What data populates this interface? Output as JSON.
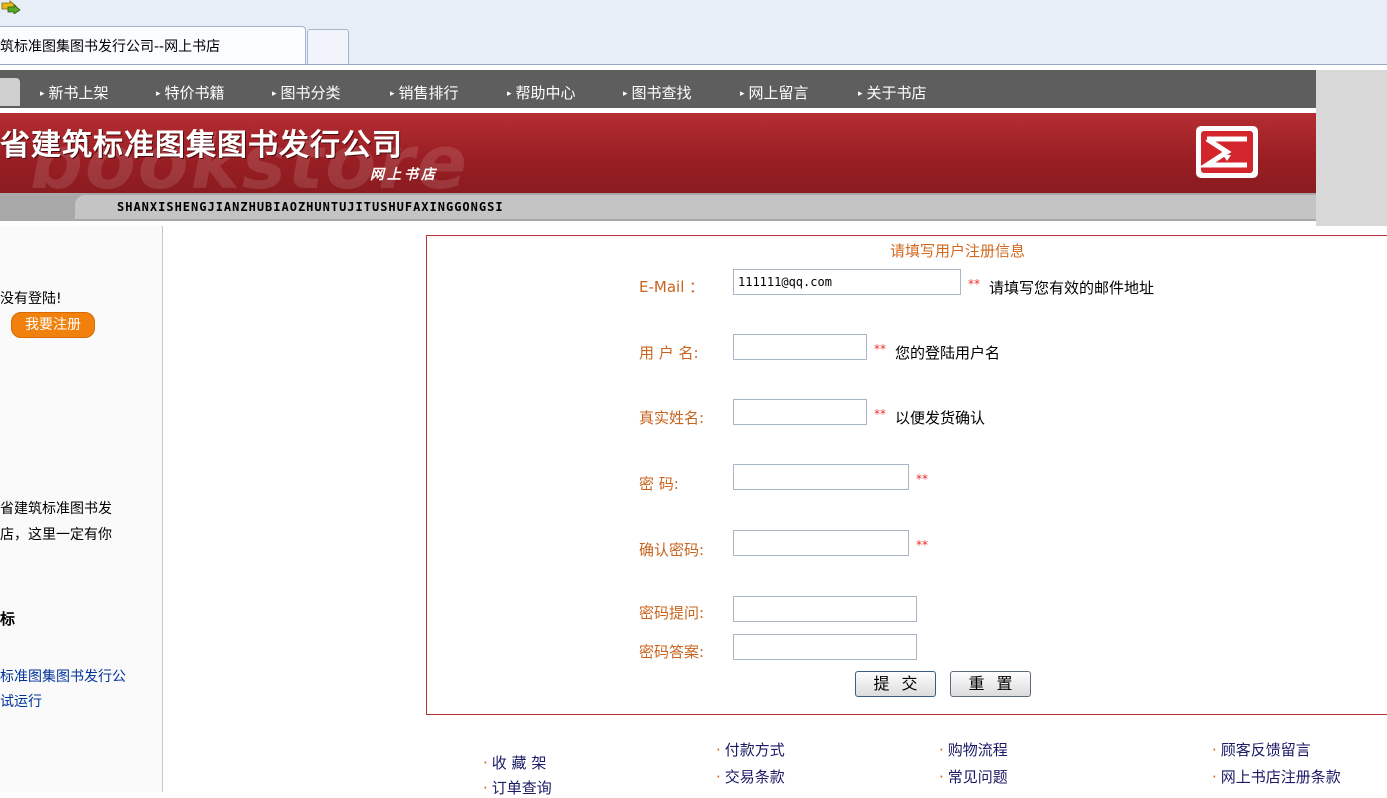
{
  "browser": {
    "tab_title": "筑标准图集图书发行公司--网上书店"
  },
  "nav": {
    "items": [
      "新书上架",
      "特价书籍",
      "图书分类",
      "销售排行",
      "帮助中心",
      "图书查找",
      "网上留言",
      "关于书店"
    ]
  },
  "banner": {
    "title": "省建筑标准图集图书发行公司",
    "subtitle": "网上书店",
    "watermark": "bookstore",
    "pinyin": "SHANXISHENGJIANZHUBIAOZHUNTUJITUSHUFAXINGGONGSI",
    "logo_icon": "company-logo-icon"
  },
  "sidebar": {
    "login_msg": "没有登陆!",
    "register_label": "我要注册",
    "intro_line1": "省建筑标准图书发",
    "intro_line2": "店，这里一定有你",
    "section_heading": "标",
    "news_line1": "标准图集图书发行公",
    "news_line2": "试运行"
  },
  "form": {
    "title": "请填写用户注册信息",
    "required_mark": "**",
    "fields": {
      "email": {
        "label": "E-Mail  ：",
        "value": "111111@qq.com",
        "hint": "请填写您有效的邮件地址"
      },
      "username": {
        "label": "用 户 名:",
        "value": "",
        "hint": "您的登陆用户名"
      },
      "realname": {
        "label": "真实姓名:",
        "value": "",
        "hint": "以便发货确认"
      },
      "password": {
        "label": "密    码:",
        "value": ""
      },
      "confirm": {
        "label": "确认密码:",
        "value": ""
      },
      "question": {
        "label": "密码提问:",
        "value": ""
      },
      "answer": {
        "label": "密码答案:",
        "value": ""
      }
    },
    "submit_label": "提交",
    "reset_label": "重置"
  },
  "footer": {
    "col1": [
      "收 藏 架",
      "订单查询"
    ],
    "col2": [
      "付款方式",
      "交易条款"
    ],
    "col3": [
      "购物流程",
      "常见问题"
    ],
    "col4": [
      "顾客反馈留言",
      "网上书店注册条款"
    ]
  },
  "colors": {
    "banner_red": "#9a1f24",
    "nav_gray": "#5e5e5e",
    "label_orange": "#c8641e",
    "required_red": "#e8302c",
    "register_orange": "#f2800c"
  }
}
